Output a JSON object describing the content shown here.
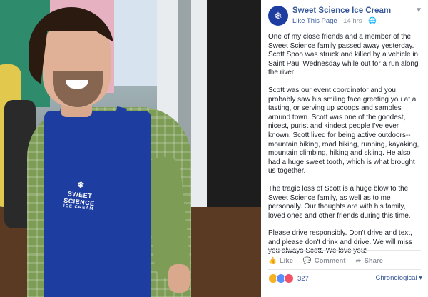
{
  "post": {
    "page_name": "Sweet Science Ice Cream",
    "like_page": "Like This Page",
    "time": "14 hrs",
    "paragraphs": [
      "One of my close friends and a member of the Sweet Science family passed away yesterday. Scott Spoo was struck and killed by a vehicle in Saint Paul Wednesday while out for a run along the river.",
      "Scott was our event coordinator and you probably saw his smiling face greeting you at a tasting, or serving up scoops and samples around town. Scott was one of the goodest, nicest, purist and kindest people I've ever known. Scott lived for being active outdoors--mountain biking, road biking, running, kayaking, mountain climbing, hiking and skiing. He also had a huge sweet tooth, which is what brought us together.",
      "The tragic loss of Scott is a huge blow to the Sweet Science family, as well as to me personally. Our thoughts are with his family, loved ones and other friends during this time.",
      "Please drive responsibly. Don't drive and text, and please don't drink and drive. We will miss you always Scott. We love you!"
    ]
  },
  "actions": {
    "like": "Like",
    "comment": "Comment",
    "share": "Share"
  },
  "reactions": {
    "count": "327",
    "colors": [
      "#f7b125",
      "#5890ff",
      "#f25268"
    ]
  },
  "sort": {
    "label": "Chronological"
  },
  "photo": {
    "apron_line1": "SWEET SCIENCE",
    "apron_line2": "ICE CREAM"
  },
  "icons": {
    "avatar": "snowflake-logo-icon",
    "globe": "globe-icon",
    "chevron": "chevron-down-icon",
    "like": "thumbs-up-icon",
    "comment": "comment-icon",
    "share": "share-icon"
  }
}
